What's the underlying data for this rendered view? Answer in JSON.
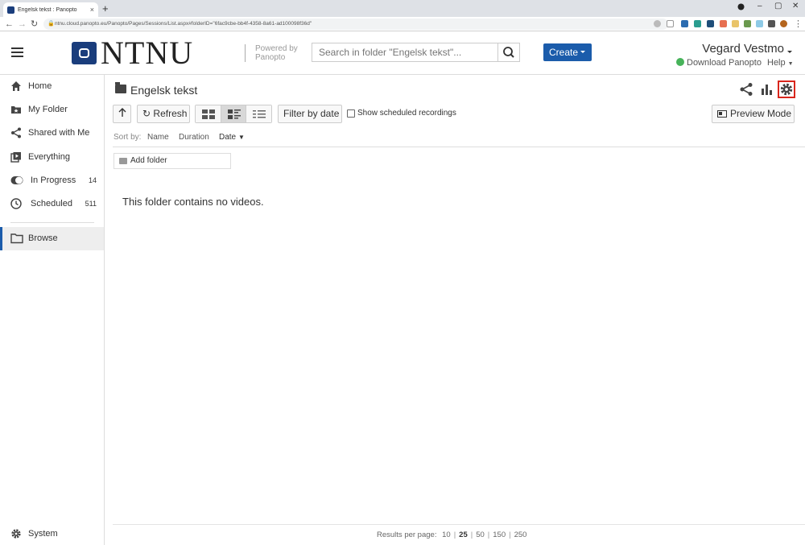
{
  "browser": {
    "tab_title": "Engelsk tekst : Panopto",
    "tab_close": "×",
    "new_tab": "+",
    "url": "ntnu.cloud.panopto.eu/Panopto/Pages/Sessions/List.aspx#folderID=\"6fac9cbe-bb4f-4358-8a61-ad100098f36d\"",
    "window_controls": [
      "–",
      "▢",
      "✕"
    ]
  },
  "header": {
    "logo_text": "NTNU",
    "powered_by": "Powered by Panopto",
    "search_placeholder": "Search in folder \"Engelsk tekst\"...",
    "create_label": "Create",
    "user_name": "Vegard Vestmo",
    "download_label": "Download Panopto",
    "help_label": "Help"
  },
  "sidebar": {
    "items": [
      {
        "label": "Home",
        "icon": "home-icon"
      },
      {
        "label": "My Folder",
        "icon": "my-folder-icon"
      },
      {
        "label": "Shared with Me",
        "icon": "share-icon"
      },
      {
        "label": "Everything",
        "icon": "everything-icon"
      },
      {
        "label": "In Progress",
        "icon": "in-progress-icon",
        "count": "14"
      },
      {
        "label": "Scheduled",
        "icon": "clock-icon",
        "count": "511"
      },
      {
        "label": "Browse",
        "icon": "folder-outline-icon"
      }
    ],
    "system_label": "System"
  },
  "main": {
    "folder_title": "Engelsk tekst",
    "refresh_label": "Refresh",
    "filter_label": "Filter by date",
    "show_scheduled_label": "Show scheduled recordings",
    "show_scheduled_checked": false,
    "preview_label": "Preview Mode",
    "sort_by_label": "Sort by:",
    "sort_options": [
      "Name",
      "Duration",
      "Date"
    ],
    "sort_active": "Date",
    "add_folder_label": "Add folder",
    "empty_message": "This folder contains no videos.",
    "results_label": "Results per page:",
    "per_page_options": [
      "10",
      "25",
      "50",
      "150",
      "250"
    ],
    "per_page_current": "25"
  },
  "colors": {
    "brand": "#1a3d7c",
    "create_button": "#1b5cab",
    "settings_highlight": "#d9261c"
  }
}
